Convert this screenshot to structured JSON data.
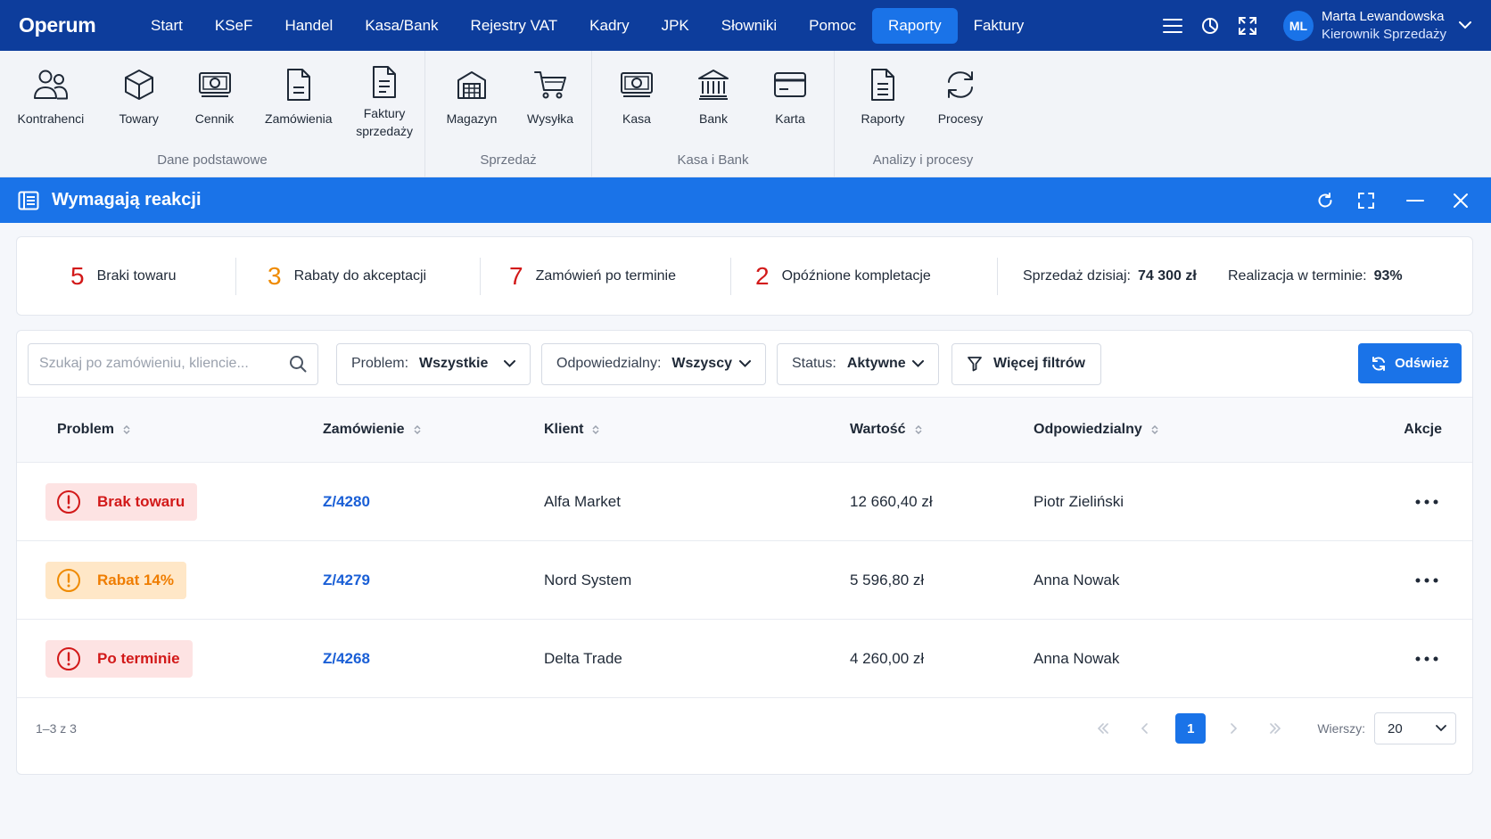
{
  "app": {
    "logo": "Operum"
  },
  "nav": {
    "items": [
      "Start",
      "KSeF",
      "Handel",
      "Kasa/Bank",
      "Rejestry VAT",
      "Kadry",
      "JPK",
      "Słowniki",
      "Pomoc",
      "Raporty",
      "Faktury"
    ],
    "active": "Raporty"
  },
  "user": {
    "initials": "ML",
    "name": "Marta Lewandowska",
    "role": "Kierownik Sprzedaży"
  },
  "ribbon": {
    "groups": [
      {
        "title": "Dane podstawowe",
        "items": [
          {
            "label": "Kontrahenci",
            "icon": "users-icon"
          },
          {
            "label": "Towary",
            "icon": "box-icon"
          },
          {
            "label": "Cennik",
            "icon": "banknote-icon"
          },
          {
            "label": "Zamówienia",
            "icon": "document-icon"
          },
          {
            "label": "Faktury sprzedaży",
            "icon": "invoice-icon"
          }
        ]
      },
      {
        "title": "Sprzedaż",
        "items": [
          {
            "label": "Magazyn",
            "icon": "warehouse-icon"
          },
          {
            "label": "Wysyłka",
            "icon": "cart-icon"
          }
        ]
      },
      {
        "title": "Kasa i Bank",
        "items": [
          {
            "label": "Kasa",
            "icon": "cash-icon"
          },
          {
            "label": "Bank",
            "icon": "bank-icon"
          },
          {
            "label": "Karta",
            "icon": "card-icon"
          }
        ]
      },
      {
        "title": "Analizy i procesy",
        "items": [
          {
            "label": "Raporty",
            "icon": "report-icon"
          },
          {
            "label": "Procesy",
            "icon": "sync-icon"
          }
        ]
      }
    ]
  },
  "panel": {
    "title": "Wymagają reakcji"
  },
  "stats": {
    "braki": {
      "num": "5",
      "label": "Braki towaru",
      "color": "#d21919"
    },
    "rabaty": {
      "num": "3",
      "label": "Rabaty do akceptacji",
      "color": "#ef8a00"
    },
    "zamowienia": {
      "num": "7",
      "label": "Zamówień po terminie",
      "color": "#d21919"
    },
    "kompletacje": {
      "num": "2",
      "label": "Opóźnione kompletacje",
      "color": "#d21919"
    },
    "sprzedaz": {
      "label": "Sprzedaż dzisiaj:",
      "value": "74 300 zł"
    },
    "realizacja": {
      "label": "Realizacja w terminie:",
      "value": "93%"
    }
  },
  "filters": {
    "search_placeholder": "Szukaj po zamówieniu, kliencie...",
    "problem": {
      "label": "Problem:",
      "value": "Wszystkie"
    },
    "odpowiedzialny": {
      "label": "Odpowiedzialny:",
      "value": "Wszyscy"
    },
    "status": {
      "label": "Status:",
      "value": "Aktywne"
    },
    "more": "Więcej filtrów",
    "refresh": "Odśwież"
  },
  "table": {
    "columns": {
      "problem": "Problem",
      "order": "Zamówienie",
      "client": "Klient",
      "value": "Wartość",
      "owner": "Odpowiedzialny",
      "actions": "Akcje"
    },
    "rows": [
      {
        "problem": "Brak towaru",
        "severity": "red",
        "order": "Z/4280",
        "client": "Alfa Market",
        "value": "12 660,40 zł",
        "owner": "Piotr Zieliński"
      },
      {
        "problem": "Rabat 14%",
        "severity": "orange",
        "order": "Z/4279",
        "client": "Nord System",
        "value": "5 596,80 zł",
        "owner": "Anna Nowak"
      },
      {
        "problem": "Po terminie",
        "severity": "red",
        "order": "Z/4268",
        "client": "Delta Trade",
        "value": "4 260,00 zł",
        "owner": "Anna Nowak"
      }
    ]
  },
  "footer": {
    "range": "1–3 z 3",
    "current_page": "1",
    "rows_label": "Wierszy:",
    "rows_value": "20"
  }
}
